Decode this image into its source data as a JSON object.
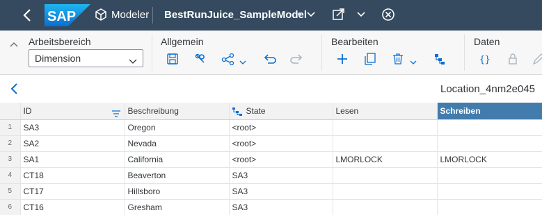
{
  "shell": {
    "logo_text": "SAP",
    "app_label": "Modeler",
    "model_name": "BestRunJuice_SampleModel",
    "brand_color": "#354a5f"
  },
  "toolbar": {
    "groups": [
      {
        "title": "Arbeitsbereich"
      },
      {
        "title": "Allgemein"
      },
      {
        "title": "Bearbeiten"
      },
      {
        "title": "Daten"
      }
    ],
    "workspace_select": {
      "value": "Dimension"
    },
    "icons": {
      "allgemein": [
        "save-icon",
        "wrench-icon",
        "share-nodes-icon",
        "undo-icon",
        "redo-icon"
      ],
      "bearbeiten": [
        "plus-icon",
        "copy-icon",
        "trash-icon",
        "hierarchy-icon"
      ],
      "daten": [
        "formula-icon",
        "lock-icon",
        "pencil-icon"
      ]
    }
  },
  "subheader": {
    "title": "Location_4nm2e045"
  },
  "grid": {
    "columns": [
      "ID",
      "Beschreibung",
      "State",
      "Lesen",
      "Schreiben"
    ],
    "highlight_color": "#427cac",
    "rows": [
      {
        "num": "1",
        "cells": [
          "SA3",
          "Oregon",
          "<root>",
          "",
          ""
        ]
      },
      {
        "num": "2",
        "cells": [
          "SA2",
          "Nevada",
          "<root>",
          "",
          ""
        ]
      },
      {
        "num": "3",
        "cells": [
          "SA1",
          "California",
          "<root>",
          "LMORLOCK",
          "LMORLOCK"
        ]
      },
      {
        "num": "4",
        "cells": [
          "CT18",
          "Beaverton",
          "SA3",
          "",
          ""
        ]
      },
      {
        "num": "5",
        "cells": [
          "CT17",
          "Hillsboro",
          "SA3",
          "",
          ""
        ]
      },
      {
        "num": "6",
        "cells": [
          "CT16",
          "Gresham",
          "SA3",
          "",
          ""
        ]
      }
    ]
  }
}
